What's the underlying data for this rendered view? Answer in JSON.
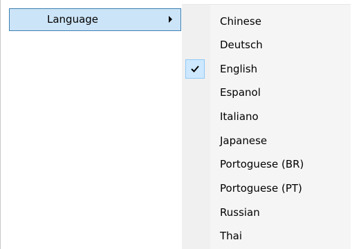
{
  "parent_menu": {
    "item_label": "Language",
    "arrow_icon": "submenu-arrow-icon"
  },
  "submenu": {
    "items": [
      {
        "label": "Chinese",
        "checked": false
      },
      {
        "label": "Deutsch",
        "checked": false
      },
      {
        "label": "English",
        "checked": true
      },
      {
        "label": "Espanol",
        "checked": false
      },
      {
        "label": "Italiano",
        "checked": false
      },
      {
        "label": "Japanese",
        "checked": false
      },
      {
        "label": "Portoguese (BR)",
        "checked": false
      },
      {
        "label": "Portoguese (PT)",
        "checked": false
      },
      {
        "label": "Russian",
        "checked": false
      },
      {
        "label": "Thai",
        "checked": false
      }
    ],
    "check_icon": "checkmark-icon"
  },
  "colors": {
    "highlight_fill": "#cce4f7",
    "highlight_border": "#3c7fb1",
    "check_fill": "#cde8ff",
    "check_border": "#90c8f6"
  }
}
